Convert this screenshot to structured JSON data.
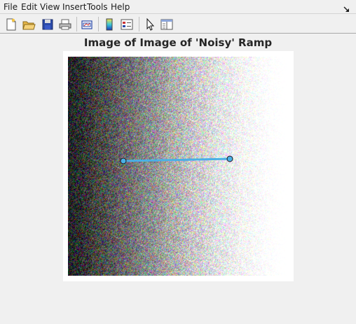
{
  "menubar": {
    "items": [
      {
        "label": "File"
      },
      {
        "label": "Edit"
      },
      {
        "label": "View"
      },
      {
        "label": "Insert"
      },
      {
        "label": "Tools"
      },
      {
        "label": "Help"
      }
    ]
  },
  "toolbar": {
    "buttons": [
      {
        "icon": "new-figure-icon"
      },
      {
        "icon": "open-file-icon"
      },
      {
        "icon": "save-icon"
      },
      {
        "icon": "print-icon"
      },
      {
        "icon": "link-plot-icon"
      },
      {
        "icon": "insert-colorbar-icon"
      },
      {
        "icon": "insert-legend-icon"
      },
      {
        "icon": "edit-plot-pointer-icon"
      },
      {
        "icon": "property-inspector-icon"
      }
    ]
  },
  "figure": {
    "title": "Image of Image of 'Noisy' Ramp"
  },
  "profile_line": {
    "color": "#4ab0e6",
    "handle_color": "#4ab0e6"
  }
}
